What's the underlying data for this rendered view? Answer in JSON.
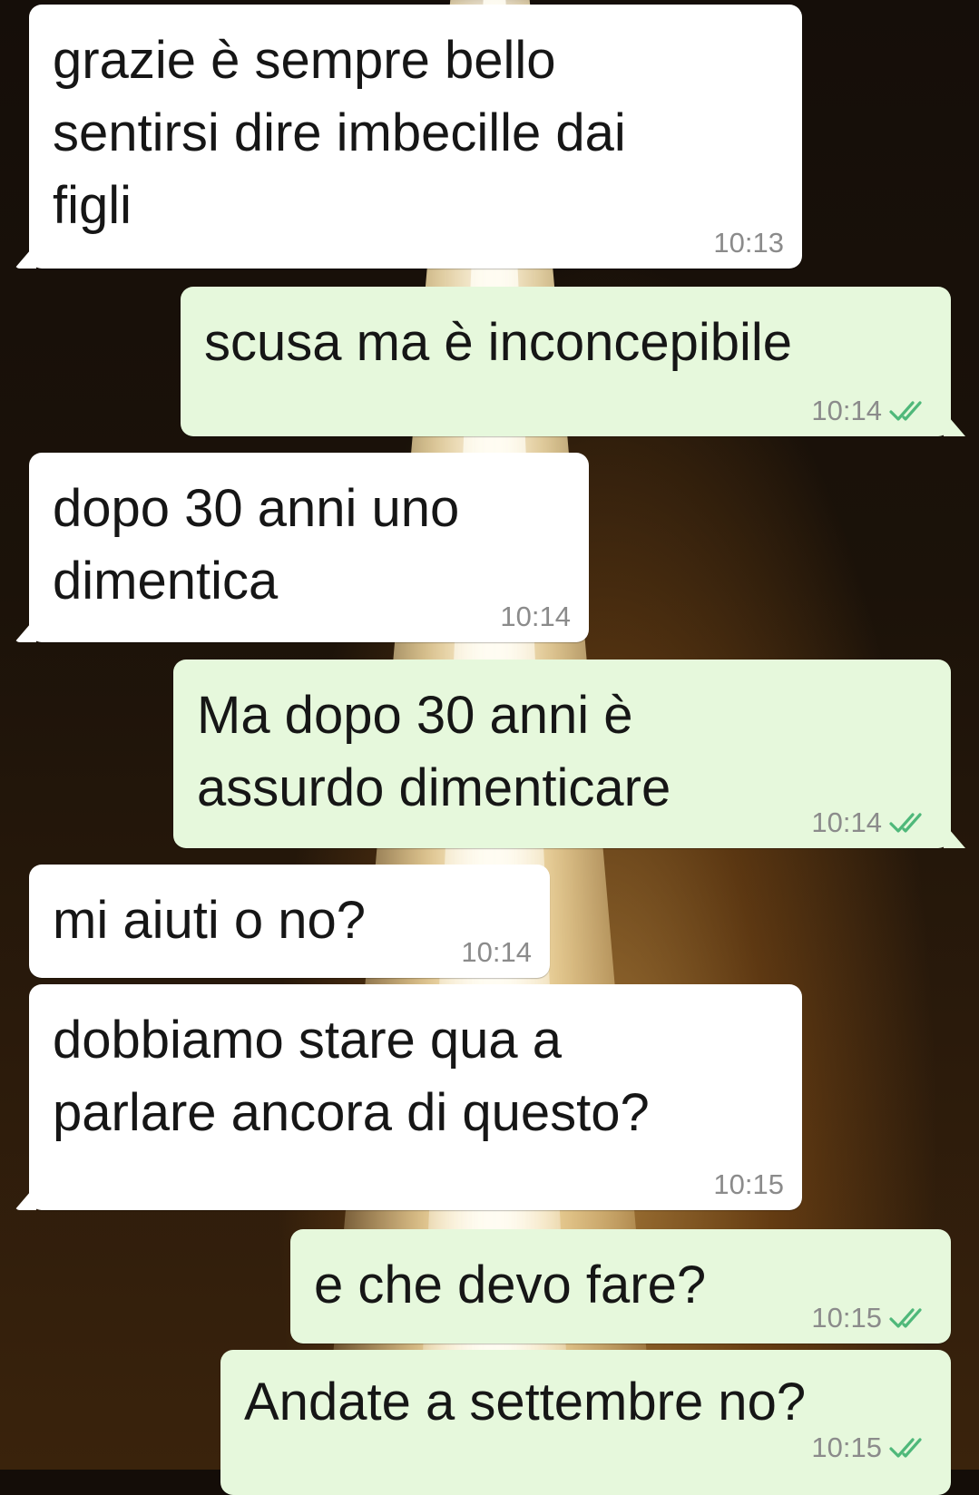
{
  "colors": {
    "incoming_bubble": "#ffffff",
    "outgoing_bubble": "#e6f8dc",
    "read_ticks": "#4fb87a",
    "timestamp": "#8b8b8b"
  },
  "messages": [
    {
      "direction": "incoming",
      "text": "grazie è sempre bello\nsentirsi dire imbecille dai\nfigli",
      "time": "10:13"
    },
    {
      "direction": "outgoing",
      "text": "scusa ma è inconcepibile",
      "time": "10:14",
      "status_icon": "double-check-icon"
    },
    {
      "direction": "incoming",
      "text": "dopo 30 anni uno\ndimentica",
      "time": "10:14"
    },
    {
      "direction": "outgoing",
      "text": "Ma dopo 30 anni è\nassurdo dimenticare",
      "time": "10:14",
      "status_icon": "double-check-icon"
    },
    {
      "direction": "incoming",
      "text": "mi aiuti o no?",
      "time": "10:14"
    },
    {
      "direction": "incoming",
      "text": "dobbiamo stare qua a\nparlare ancora di questo?",
      "time": "10:15"
    },
    {
      "direction": "outgoing",
      "text": "e che devo fare?",
      "time": "10:15",
      "status_icon": "double-check-icon"
    },
    {
      "direction": "outgoing",
      "text": "Andate a settembre no?",
      "time": "10:15",
      "status_icon": "double-check-icon"
    }
  ]
}
